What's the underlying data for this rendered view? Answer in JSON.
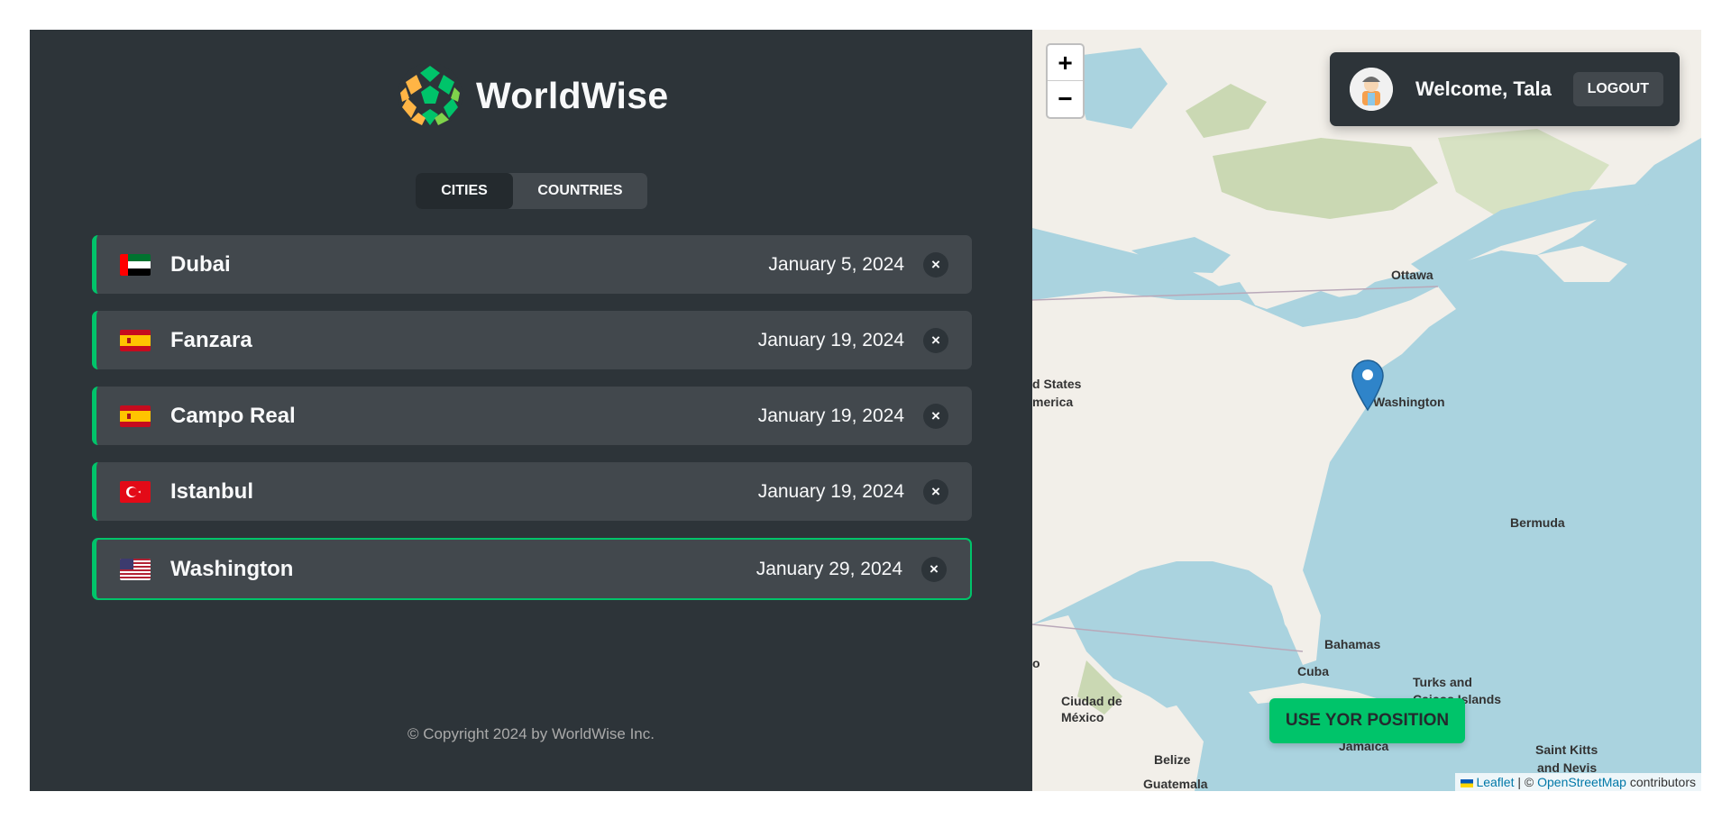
{
  "brand": {
    "name": "WorldWise"
  },
  "tabs": [
    {
      "label": "CITIES",
      "active": true
    },
    {
      "label": "COUNTRIES",
      "active": false
    }
  ],
  "cities": [
    {
      "name": "Dubai",
      "date": "January 5, 2024",
      "flag": "ae-flag-icon",
      "delete_label": "×"
    },
    {
      "name": "Fanzara",
      "date": "January 19, 2024",
      "flag": "es-flag-icon",
      "delete_label": "×"
    },
    {
      "name": "Campo Real",
      "date": "January 19, 2024",
      "flag": "es-flag-icon",
      "delete_label": "×"
    },
    {
      "name": "Istanbul",
      "date": "January 19, 2024",
      "flag": "tr-flag-icon",
      "delete_label": "×"
    },
    {
      "name": "Washington",
      "date": "January 29, 2024",
      "flag": "us-flag-icon",
      "delete_label": "×",
      "active": true
    }
  ],
  "footer": {
    "copyright": "© Copyright 2024 by WorldWise Inc."
  },
  "map": {
    "zoom_in": "+",
    "zoom_out": "−",
    "user": {
      "welcome": "Welcome, Tala",
      "logout": "LOGOUT"
    },
    "position_button": "USE YOR POSITION",
    "attribution": {
      "leaflet": "Leaflet",
      "sep": " | © ",
      "osm": "OpenStreetMap",
      "suffix": " contributors"
    },
    "labels": {
      "ottawa": "Ottawa",
      "washington": "Washington",
      "states_line1": "d States",
      "states_line2": "merica",
      "bermuda": "Bermuda",
      "bahamas": "Bahamas",
      "cuba": "Cuba",
      "turks_line1": "Turks and",
      "turks_line2": "Caicos Islands",
      "ciudad_line1": "Ciudad de",
      "ciudad_line2": "México",
      "jamaica": "Jamaica",
      "belize": "Belize",
      "guatemala": "Guatemala",
      "kitts_line1": "Saint Kitts",
      "kitts_line2": "and Nevis",
      "edge_o": "o"
    }
  },
  "colors": {
    "accent": "#00c46a",
    "dark0": "#242a2e",
    "dark1": "#2d3439",
    "dark2": "#42484d",
    "text": "#f8f9fa",
    "water": "#aad3df"
  }
}
